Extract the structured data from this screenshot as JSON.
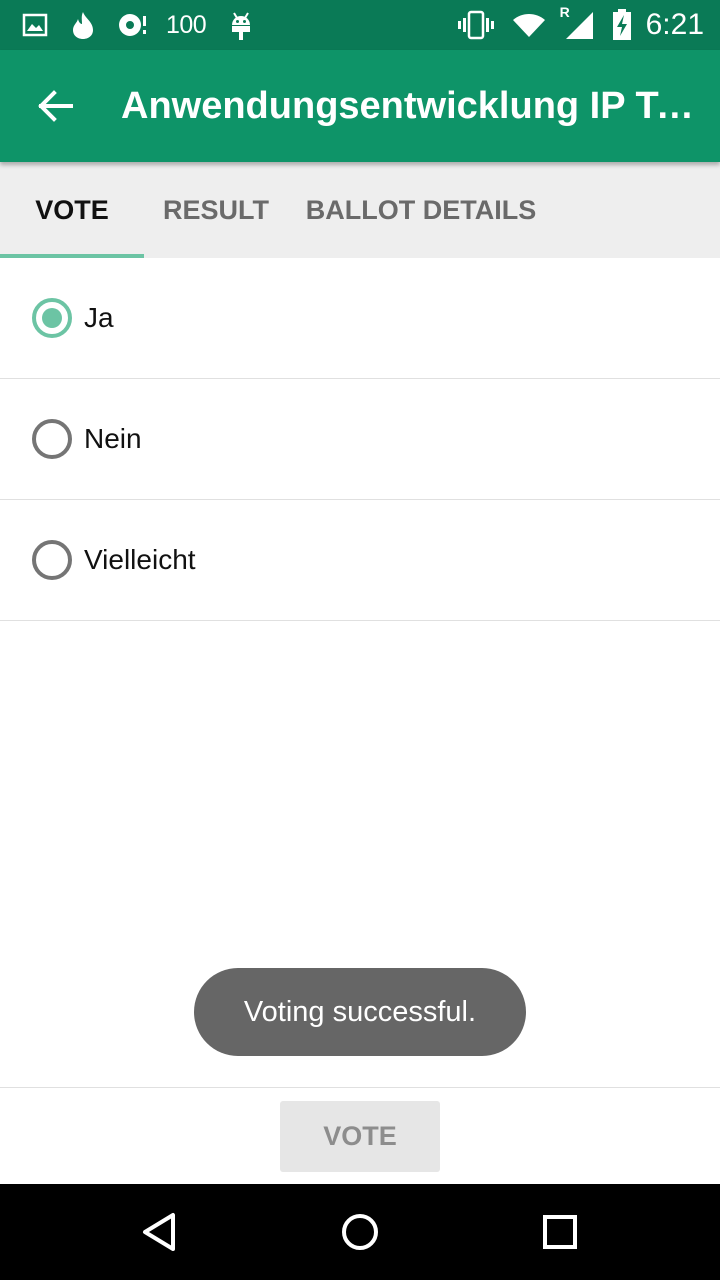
{
  "status_bar": {
    "notification_count": "100",
    "time": "6:21",
    "network_roaming": "R",
    "icons": [
      "image-icon",
      "flame-icon",
      "voicemail-icon",
      "android-icon",
      "vibrate-icon",
      "wifi-icon",
      "cell-signal-icon",
      "battery-charging-icon"
    ]
  },
  "toolbar": {
    "title": "Anwendungsentwicklung IP Telefonie",
    "back_icon": "arrow-back-icon",
    "background_color": "#0e9468"
  },
  "tabs": [
    {
      "label": "VOTE",
      "active": true
    },
    {
      "label": "RESULT",
      "active": false
    },
    {
      "label": "BALLOT DETAILS",
      "active": false
    }
  ],
  "options": [
    {
      "label": "Ja",
      "selected": true
    },
    {
      "label": "Nein",
      "selected": false
    },
    {
      "label": "Vielleicht",
      "selected": false
    }
  ],
  "toast": {
    "message": "Voting successful."
  },
  "footer": {
    "vote_button_label": "VOTE",
    "vote_button_enabled": false
  },
  "nav_bar": {
    "icons": [
      "back-triangle-icon",
      "home-circle-icon",
      "recents-square-icon"
    ]
  },
  "colors": {
    "status_bar": "#0a7a56",
    "accent": "#6cc4a4",
    "toast": "#666666"
  }
}
